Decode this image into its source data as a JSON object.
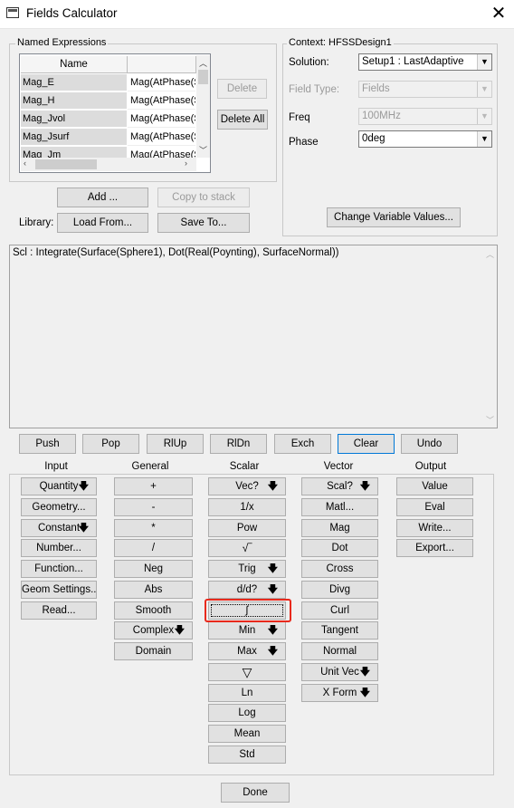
{
  "window": {
    "title": "Fields Calculator",
    "close_glyph": "✕"
  },
  "named_expressions": {
    "group_title": "Named Expressions",
    "columns": [
      "Name",
      ""
    ],
    "rows": [
      {
        "name": "Mag_E",
        "expr": "Mag(AtPhase(S"
      },
      {
        "name": "Mag_H",
        "expr": "Mag(AtPhase(S"
      },
      {
        "name": "Mag_Jvol",
        "expr": "Mag(AtPhase(S"
      },
      {
        "name": "Mag_Jsurf",
        "expr": "Mag(AtPhase(S"
      },
      {
        "name": "Mag_Jm",
        "expr": "Mag(AtPhase(S"
      }
    ],
    "delete_label": "Delete",
    "delete_all_label": "Delete All",
    "add_label": "Add ...",
    "copy_to_stack_label": "Copy to stack",
    "library_label": "Library:",
    "load_from_label": "Load From...",
    "save_to_label": "Save To..."
  },
  "context": {
    "group_title": "Context: HFSSDesign1",
    "solution_label": "Solution:",
    "solution_value": "Setup1 : LastAdaptive",
    "field_type_label": "Field Type:",
    "field_type_value": "Fields",
    "freq_label": "Freq",
    "freq_value": "100MHz",
    "phase_label": "Phase",
    "phase_value": "0deg",
    "change_vars_label": "Change Variable Values..."
  },
  "stack": {
    "top_line": "Scl : Integrate(Surface(Sphere1), Dot(Real(Poynting), SurfaceNormal))"
  },
  "stack_buttons": [
    "Push",
    "Pop",
    "RlUp",
    "RlDn",
    "Exch",
    "Clear",
    "Undo"
  ],
  "columns": {
    "input": {
      "title": "Input",
      "items": [
        {
          "label": "Quantity",
          "arrow": true
        },
        {
          "label": "Geometry...",
          "arrow": false
        },
        {
          "label": "Constant",
          "arrow": true
        },
        {
          "label": "Number...",
          "arrow": false
        },
        {
          "label": "Function...",
          "arrow": false
        },
        {
          "label": "Geom Settings...",
          "arrow": false
        },
        {
          "label": "Read...",
          "arrow": false
        }
      ]
    },
    "general": {
      "title": "General",
      "items": [
        {
          "label": "+",
          "arrow": false
        },
        {
          "label": "-",
          "arrow": false
        },
        {
          "label": "*",
          "arrow": false
        },
        {
          "label": "/",
          "arrow": false
        },
        {
          "label": "Neg",
          "arrow": false
        },
        {
          "label": "Abs",
          "arrow": false
        },
        {
          "label": "Smooth",
          "arrow": false
        },
        {
          "label": "Complex",
          "arrow": true
        },
        {
          "label": "Domain",
          "arrow": false
        }
      ]
    },
    "scalar": {
      "title": "Scalar",
      "items": [
        {
          "label": "Vec?",
          "arrow": true
        },
        {
          "label": "1/x",
          "arrow": false
        },
        {
          "label": "Pow",
          "arrow": false
        },
        {
          "label": "√‾",
          "arrow": false
        },
        {
          "label": "Trig",
          "arrow": true
        },
        {
          "label": "d/d?",
          "arrow": true
        },
        {
          "label": "∫",
          "arrow": false
        },
        {
          "label": "Min",
          "arrow": true
        },
        {
          "label": "Max",
          "arrow": true
        },
        {
          "label": "▽",
          "arrow": false
        },
        {
          "label": "Ln",
          "arrow": false
        },
        {
          "label": "Log",
          "arrow": false
        },
        {
          "label": "Mean",
          "arrow": false
        },
        {
          "label": "Std",
          "arrow": false
        }
      ]
    },
    "vector": {
      "title": "Vector",
      "items": [
        {
          "label": "Scal?",
          "arrow": true
        },
        {
          "label": "Matl...",
          "arrow": false
        },
        {
          "label": "Mag",
          "arrow": false
        },
        {
          "label": "Dot",
          "arrow": false
        },
        {
          "label": "Cross",
          "arrow": false
        },
        {
          "label": "Divg",
          "arrow": false
        },
        {
          "label": "Curl",
          "arrow": false
        },
        {
          "label": "Tangent",
          "arrow": false
        },
        {
          "label": "Normal",
          "arrow": false
        },
        {
          "label": "Unit Vec",
          "arrow": true
        },
        {
          "label": "X Form",
          "arrow": true
        }
      ]
    },
    "output": {
      "title": "Output",
      "items": [
        {
          "label": "Value",
          "arrow": false
        },
        {
          "label": "Eval",
          "arrow": false
        },
        {
          "label": "Write...",
          "arrow": false
        },
        {
          "label": "Export...",
          "arrow": false
        }
      ]
    }
  },
  "arrow_glyph": "🡇",
  "done_label": "Done",
  "highlight_color": "#e8291c"
}
